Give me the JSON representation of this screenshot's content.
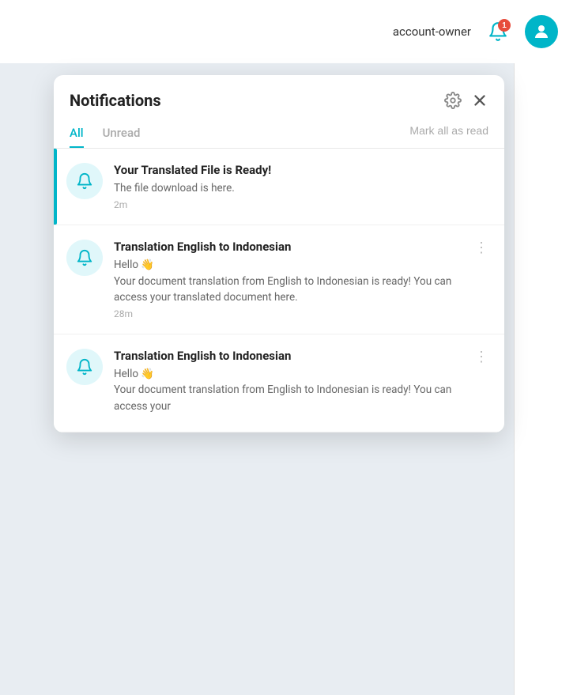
{
  "topbar": {
    "account_name": "account-owner",
    "badge_count": "1"
  },
  "panel": {
    "title": "Notifications",
    "tabs": [
      {
        "label": "All",
        "active": true
      },
      {
        "label": "Unread",
        "active": false
      }
    ],
    "mark_all_label": "Mark all as read",
    "notifications": [
      {
        "id": 1,
        "unread": true,
        "title": "Your Translated File is Ready!",
        "body": "The file download is here.",
        "time": "2m",
        "has_menu": false
      },
      {
        "id": 2,
        "unread": false,
        "title": "Translation English to Indonesian",
        "body": "Hello 👋\nYour document translation from English to Indonesian is ready! You can access your translated document here.",
        "time": "28m",
        "has_menu": true
      },
      {
        "id": 3,
        "unread": false,
        "title": "Translation English to Indonesian",
        "body": "Hello 👋\nYour document translation from English to Indonesian is ready! You can access your",
        "time": "",
        "has_menu": true
      }
    ]
  }
}
